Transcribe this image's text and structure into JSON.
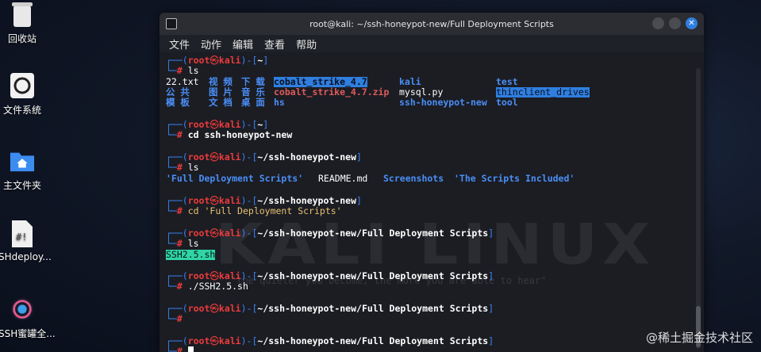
{
  "desktop": {
    "icons": [
      {
        "label": "回收站",
        "icon": "trash-icon"
      },
      {
        "label": "文件系统",
        "icon": "drive-icon"
      },
      {
        "label": "主文件夹",
        "icon": "home-folder-icon"
      },
      {
        "label": "SHdeploy...",
        "icon": "script-file-icon"
      },
      {
        "label": "SSH蜜罐全...",
        "icon": "app-launcher-icon"
      }
    ]
  },
  "terminal": {
    "title": "root@kali: ~/ssh-honeypot-new/Full Deployment Scripts",
    "menu": [
      "文件",
      "动作",
      "编辑",
      "查看",
      "帮助"
    ],
    "prompt": {
      "user": "root",
      "at": "㉿",
      "host": "kali",
      "hash": "#"
    },
    "blocks": [
      {
        "path": "~",
        "cmd": "ls"
      },
      {
        "path": "~",
        "cmd": "cd ssh-honeypot-new"
      },
      {
        "path": "~/ssh-honeypot-new",
        "cmd": "ls"
      },
      {
        "path": "~/ssh-honeypot-new",
        "cmd": "cd 'Full Deployment Scripts'"
      },
      {
        "path": "~/ssh-honeypot-new/Full Deployment Scripts",
        "cmd": "ls"
      },
      {
        "path": "~/ssh-honeypot-new/Full Deployment Scripts",
        "cmd": "./SSH2.5.sh"
      },
      {
        "path": "~/ssh-honeypot-new/Full Deployment Scripts",
        "cmd": ""
      },
      {
        "path": "~/ssh-honeypot-new/Full Deployment Scripts",
        "cmd": ""
      }
    ],
    "ls_home": {
      "row1": [
        "22.txt",
        "视 频",
        "下 载",
        "cobalt_strike_4.7",
        "kali",
        "test"
      ],
      "row2": [
        "公 共",
        "图 片",
        "音 乐",
        "cobalt_strike_4.7.zip",
        "mysql.py",
        "thinclient_drives"
      ],
      "row3": [
        "模 板",
        "文 档",
        "桌 面",
        "hs",
        "ssh-honeypot-new",
        "tool"
      ]
    },
    "ls_honeypot": [
      "'Full Deployment Scripts'",
      "README.md",
      "Screenshots",
      "'The Scripts Included'"
    ],
    "ls_scripts": [
      "SSH2.5.sh"
    ],
    "watermark": "KALI LINUX",
    "watermark_sub": "\"the quieter you become, the more you are able to hear\""
  },
  "corner_watermark": "@稀土掘金技术社区",
  "colors": {
    "accent": "#2f7fe0",
    "prompt_blue": "#3b82f6",
    "prompt_red": "#ef3b3b",
    "exec_green": "#2fd6a3"
  }
}
